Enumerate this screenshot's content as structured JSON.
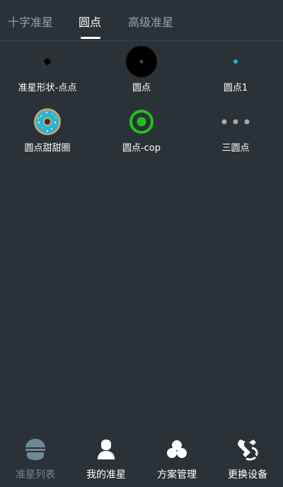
{
  "tabs": [
    {
      "label": "十字准星",
      "active": false
    },
    {
      "label": "圆点",
      "active": true
    },
    {
      "label": "高级准星",
      "active": false
    }
  ],
  "crosshairs": [
    {
      "label": "准星形状-点点",
      "icon": "small-dot-icon"
    },
    {
      "label": "圆点",
      "icon": "black-circle-icon"
    },
    {
      "label": "圆点1",
      "icon": "teal-dot-icon"
    },
    {
      "label": "圆点甜甜圈",
      "icon": "donut-icon"
    },
    {
      "label": "圆点-cop",
      "icon": "green-ring-icon"
    },
    {
      "label": "三圆点",
      "icon": "three-dots-icon"
    }
  ],
  "bottom_nav": [
    {
      "label": "准星列表",
      "icon": "crosshair-list-icon",
      "active": true
    },
    {
      "label": "我的准星",
      "icon": "user-icon",
      "active": false
    },
    {
      "label": "方案管理",
      "icon": "clover-icon",
      "active": false
    },
    {
      "label": "更换设备",
      "icon": "device-switch-icon",
      "active": false
    }
  ],
  "colors": {
    "background": "#2a3238",
    "tab_inactive": "#9aa2a8",
    "nav_active": "#6f8896",
    "teal": "#1fb8c4",
    "green": "#22c01a"
  }
}
